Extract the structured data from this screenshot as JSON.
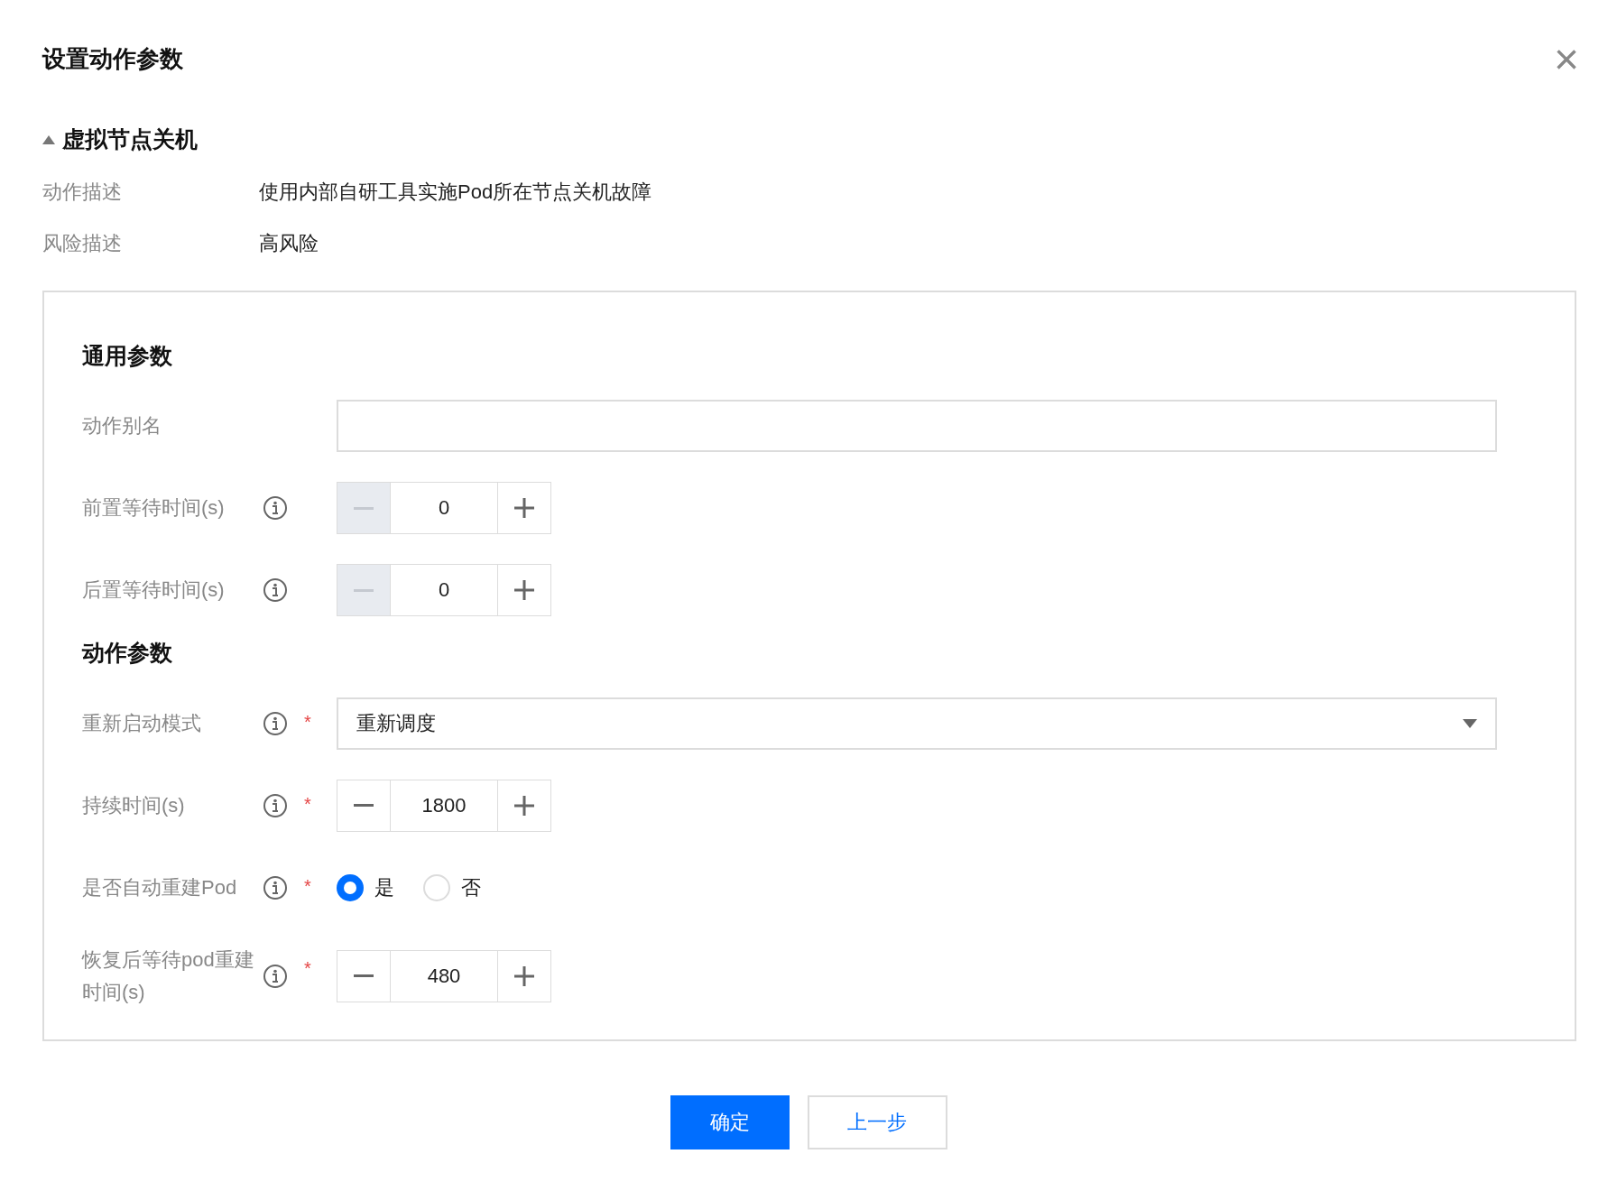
{
  "dialog": {
    "title": "设置动作参数",
    "close": "×"
  },
  "action": {
    "name": "虚拟节点关机",
    "expanded": true,
    "details": [
      {
        "label": "动作描述",
        "value": "使用内部自研工具实施Pod所在节点关机故障"
      },
      {
        "label": "风险描述",
        "value": "高风险"
      }
    ]
  },
  "sections": [
    {
      "title": "通用参数",
      "fields": [
        {
          "kind": "text",
          "label": "动作别名",
          "info": false
        },
        {
          "kind": "stepper",
          "label": "前置等待时间(s)",
          "info": true,
          "value": "0",
          "decrement_disabled": true
        },
        {
          "kind": "stepper",
          "label": "后置等待时间(s)",
          "info": true,
          "value": "0",
          "decrement_disabled": true
        }
      ]
    },
    {
      "title": "动作参数",
      "fields": [
        {
          "kind": "select",
          "label": "重新启动模式",
          "info": true,
          "required_mark": "*",
          "value": "重新调度"
        },
        {
          "kind": "stepper",
          "label": "持续时间(s)",
          "info": true,
          "required_mark": "*",
          "value": "1800",
          "decrement_disabled": false
        },
        {
          "kind": "radio",
          "label": "是否自动重建Pod",
          "info": true,
          "required_mark": "*",
          "options": [
            {
              "label": "是",
              "selected": true
            },
            {
              "label": "否",
              "selected": false
            }
          ]
        },
        {
          "kind": "stepper",
          "label": "恢复后等待pod重建时间(s)",
          "info": true,
          "required_mark": "*",
          "value": "480",
          "decrement_disabled": false
        }
      ]
    }
  ],
  "buttons": [
    {
      "kind": "primary",
      "label": "确定"
    },
    {
      "kind": "secondary",
      "label": "上一步"
    }
  ]
}
